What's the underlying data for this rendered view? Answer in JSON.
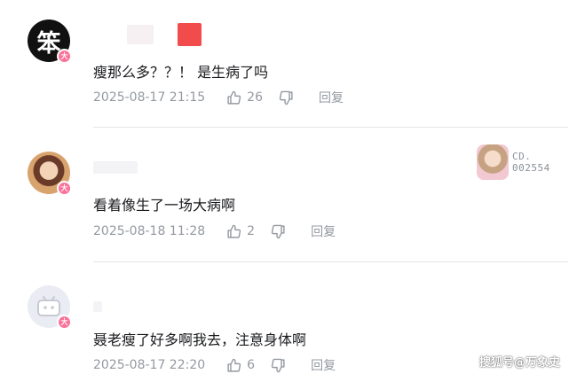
{
  "comments": [
    {
      "avatar_glyph": "笨",
      "level": "大",
      "text": "瘦那么多？？！ 是生病了吗",
      "time": "2025-08-17 21:15",
      "likes": "26",
      "reply": "回复"
    },
    {
      "level": "大",
      "text": "看着像生了一场大病啊",
      "time": "2025-08-18 11:28",
      "likes": "2",
      "reply": "回复",
      "decoration_text_line1": "CD.",
      "decoration_text_line2": "002554"
    },
    {
      "level": "大",
      "text": "聂老瘦了好多啊我去，注意身体啊",
      "time": "2025-08-17 22:20",
      "likes": "6",
      "reply": "回复"
    }
  ],
  "watermark": "搜狐号@万象史",
  "colors": {
    "badge": "#fb7299",
    "meta": "#9499a0",
    "text": "#18191c",
    "red_block": "#f24b4b"
  },
  "icons": [
    "thumbs-up-icon",
    "thumbs-down-icon"
  ]
}
